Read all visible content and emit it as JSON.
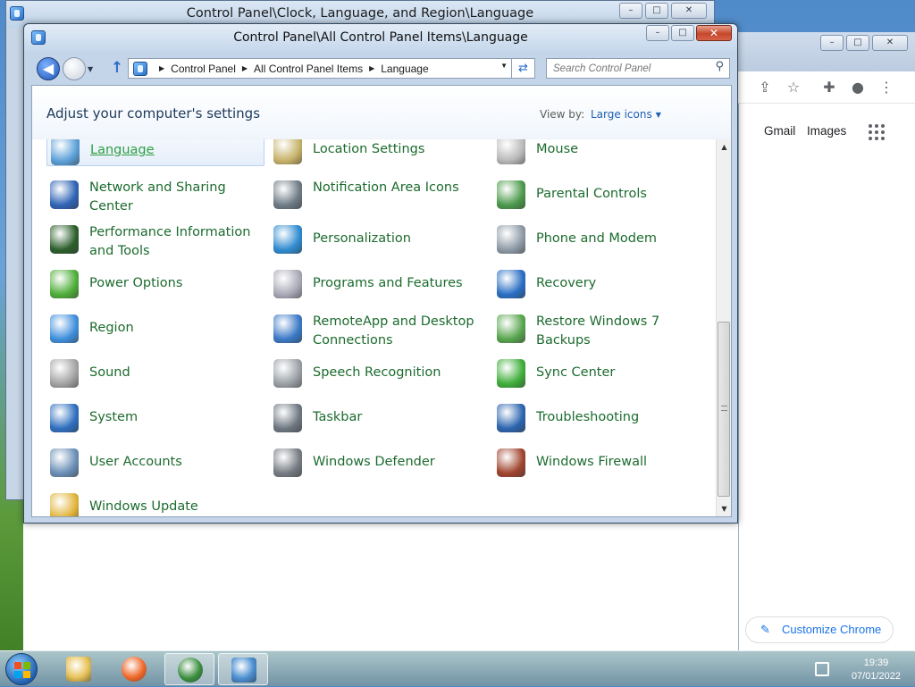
{
  "background_window": {
    "title": "Control Panel\\Clock, Language, and Region\\Language",
    "min": "–",
    "max": "□",
    "close": "✕"
  },
  "main_window": {
    "title": "Control Panel\\All Control Panel Items\\Language",
    "min": "–",
    "max": "□",
    "close": "✕"
  },
  "navigation": {
    "back": "◀",
    "breadcrumbs": [
      "Control Panel",
      "All Control Panel Items",
      "Language"
    ],
    "search_placeholder": "Search Control Panel"
  },
  "header": {
    "title": "Adjust your computer's settings",
    "view_by_label": "View by:",
    "view_by_value": "Large icons"
  },
  "items": [
    {
      "label": "Language",
      "icon": "language-icon",
      "color": "#5a9fd8",
      "selected": true
    },
    {
      "label": "Location Settings",
      "icon": "location-icon",
      "color": "#c7b36a"
    },
    {
      "label": "Mouse",
      "icon": "mouse-icon",
      "color": "#b9b9b9"
    },
    {
      "label": "Network and Sharing Center",
      "icon": "network-icon",
      "color": "#2f64b5"
    },
    {
      "label": "Notification Area Icons",
      "icon": "notification-icon",
      "color": "#6e7b86"
    },
    {
      "label": "Parental Controls",
      "icon": "parental-icon",
      "color": "#4c9a4c"
    },
    {
      "label": "Performance Information and Tools",
      "icon": "performance-icon",
      "color": "#2c5f2c"
    },
    {
      "label": "Personalization",
      "icon": "personalization-icon",
      "color": "#2f8bd0"
    },
    {
      "label": "Phone and Modem",
      "icon": "phone-icon",
      "color": "#8e9aa6"
    },
    {
      "label": "Power Options",
      "icon": "power-icon",
      "color": "#4fae3a"
    },
    {
      "label": "Programs and Features",
      "icon": "programs-icon",
      "color": "#a9a9b8"
    },
    {
      "label": "Recovery",
      "icon": "recovery-icon",
      "color": "#2b6fc4"
    },
    {
      "label": "Region",
      "icon": "region-icon",
      "color": "#3f8fdc"
    },
    {
      "label": "RemoteApp and Desktop Connections",
      "icon": "remoteapp-icon",
      "color": "#3b79c6"
    },
    {
      "label": "Restore Windows 7 Backups",
      "icon": "restore-icon",
      "color": "#58a64e"
    },
    {
      "label": "Sound",
      "icon": "sound-icon",
      "color": "#a3a3a3"
    },
    {
      "label": "Speech Recognition",
      "icon": "microphone-icon",
      "color": "#9aa0a6"
    },
    {
      "label": "Sync Center",
      "icon": "sync-icon",
      "color": "#3fae3a"
    },
    {
      "label": "System",
      "icon": "system-icon",
      "color": "#2f6fbf"
    },
    {
      "label": "Taskbar",
      "icon": "taskbar-icon",
      "color": "#6e7781"
    },
    {
      "label": "Troubleshooting",
      "icon": "troubleshooting-icon",
      "color": "#2c65b0"
    },
    {
      "label": "User Accounts",
      "icon": "user-accounts-icon",
      "color": "#6a8fb6"
    },
    {
      "label": "Windows Defender",
      "icon": "defender-icon",
      "color": "#767c83"
    },
    {
      "label": "Windows Firewall",
      "icon": "firewall-icon",
      "color": "#a0452f"
    },
    {
      "label": "Windows Update",
      "icon": "update-icon",
      "color": "#e1b43a"
    }
  ],
  "chrome": {
    "gmail": "Gmail",
    "images": "Images",
    "customize": "Customize Chrome"
  },
  "taskbar": {
    "apps": [
      {
        "name": "file-explorer-icon",
        "color": "#e8c35a"
      },
      {
        "name": "firefox-icon",
        "color": "#f0682a"
      },
      {
        "name": "chrome-icon",
        "color": "#3b8e3f"
      },
      {
        "name": "control-panel-icon",
        "color": "#4c8fd1"
      }
    ],
    "time": "19:39",
    "date": "07/01/2022"
  }
}
